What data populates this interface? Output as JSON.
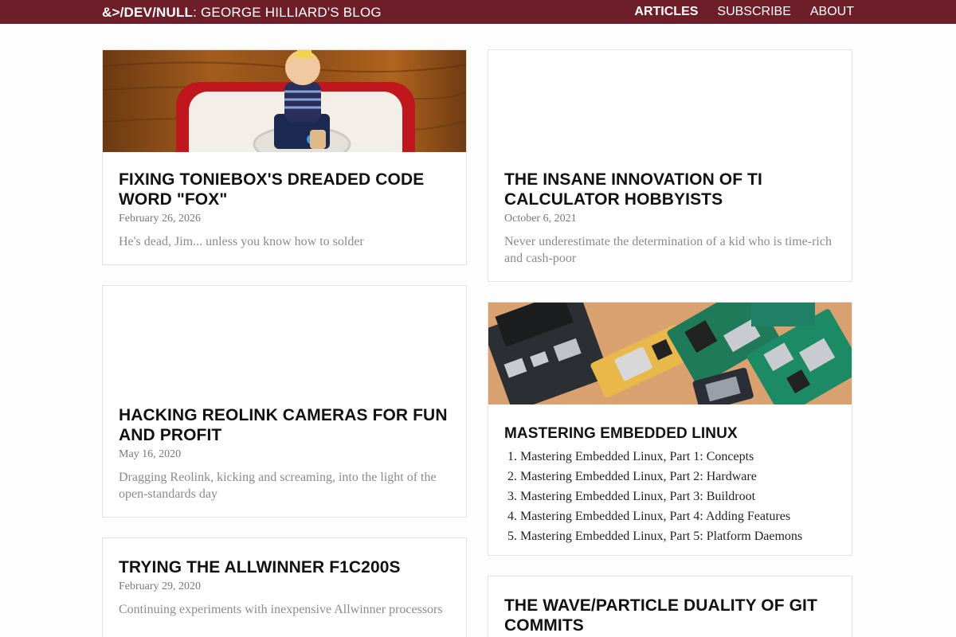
{
  "header": {
    "brand_bold": "&>/DEV/NULL",
    "brand_rest": ": GEORGE HILLIARD'S BLOG",
    "nav": [
      {
        "label": "ARTICLES",
        "active": true
      },
      {
        "label": "SUBSCRIBE",
        "active": false
      },
      {
        "label": "ABOUT",
        "active": false
      }
    ]
  },
  "cards": {
    "toniebox": {
      "title": "FIXING TONIEBOX'S DREADED CODE WORD \"FOX\"",
      "date": "February 26, 2026",
      "desc": "He's dead, Jim... unless you know how to solder"
    },
    "ti": {
      "title": "THE INSANE INNOVATION OF TI CALCULATOR HOBBYISTS",
      "date": "October 6, 2021",
      "desc": "Never underestimate the determination of a kid who is time-rich and cash-poor"
    },
    "reolink": {
      "title": "HACKING REOLINK CAMERAS FOR FUN AND PROFIT",
      "date": "May 16, 2020",
      "desc": "Dragging Reolink, kicking and screaming, into the light of the open-standards day"
    },
    "embedded": {
      "title": "MASTERING EMBEDDED LINUX",
      "items": [
        "Mastering Embedded Linux, Part 1: Concepts",
        "Mastering Embedded Linux, Part 2: Hardware",
        "Mastering Embedded Linux, Part 3: Buildroot",
        "Mastering Embedded Linux, Part 4: Adding Features",
        "Mastering Embedded Linux, Part 5: Platform Daemons"
      ]
    },
    "allwinner": {
      "title": "TRYING THE ALLWINNER F1C200S",
      "date": "February 29, 2020",
      "desc": "Continuing experiments with inexpensive Allwinner processors"
    },
    "git": {
      "title": "THE WAVE/PARTICLE DUALITY OF GIT COMMITS"
    }
  }
}
